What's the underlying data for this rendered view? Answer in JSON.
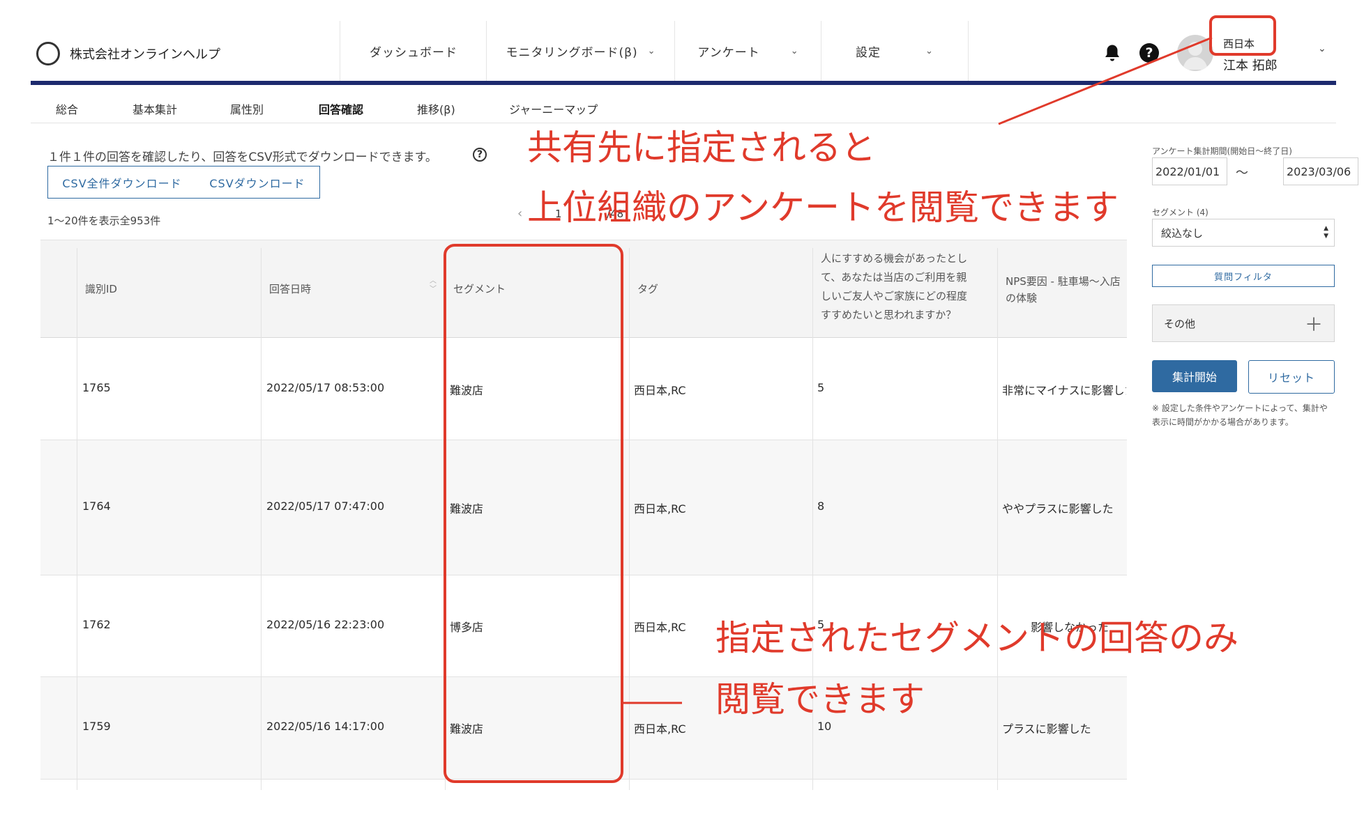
{
  "header": {
    "company": "株式会社オンラインヘルプ",
    "nav": [
      {
        "label": "ダッシュボード",
        "caret": ""
      },
      {
        "label": "モニタリングボード(β)",
        "caret": "⌄"
      },
      {
        "label": "アンケート",
        "caret": "⌄"
      },
      {
        "label": "設定",
        "caret": "⌄"
      }
    ],
    "user_org": "西日本",
    "user_name": "江本 拓郎",
    "user_caret": "⌄"
  },
  "subtabs": [
    "総合",
    "基本集計",
    "属性別",
    "回答確認",
    "推移(β)",
    "ジャーニーマップ"
  ],
  "main": {
    "description": "１件１件の回答を確認したり、回答をCSV形式でダウンロードできます。",
    "csv_all_button": "CSV全件ダウンロード",
    "csv_button": "CSVダウンロード",
    "count_text": "1〜20件を表示全953件",
    "pager_current": "1",
    "pager_total": "/48"
  },
  "table": {
    "headers": [
      "識別ID",
      "回答日時",
      "セグメント",
      "タグ",
      "人にすすめる機会があったとして、あなたは当店のご利用を親しいご友人やご家族にどの程度すすめたいと思われますか？",
      "NPS要因 - 駐車場〜入店の体験"
    ],
    "rows": [
      [
        "1765",
        "2022/05/17 08:53:00",
        "難波店",
        "西日本,RC",
        "5",
        "非常にマイナスに影響した"
      ],
      [
        "1764",
        "2022/05/17 07:47:00",
        "難波店",
        "西日本,RC",
        "8",
        "ややプラスに影響した"
      ],
      [
        "1762",
        "2022/05/16 22:23:00",
        "博多店",
        "西日本,RC",
        "5",
        "影響しなかった"
      ],
      [
        "1759",
        "2022/05/16 14:17:00",
        "難波店",
        "西日本,RC",
        "10",
        "プラスに影響した"
      ]
    ]
  },
  "sidebar": {
    "period_label": "アンケート集計期間(開始日〜終了日)",
    "start_date": "2022/01/01",
    "range_sep": "〜",
    "end_date": "2023/03/06",
    "segment_label": "セグメント (4)",
    "segment_value": "絞込なし",
    "question_filter": "質問フィルタ",
    "other_label": "その他",
    "start_button": "集計開始",
    "reset_button": "リセット",
    "note": "※ 設定した条件やアンケートによって、集計や表示に時間がかかる場合があります。"
  },
  "annotations": {
    "top_line1": "共有先に指定されると",
    "top_line2": "上位組織のアンケートを閲覧できます",
    "bottom_line1": "指定されたセグメントの回答のみ",
    "bottom_line2": "閲覧できます"
  },
  "colors": {
    "brand_bar": "#1d2a6e",
    "accent": "#2f6aa1",
    "annotation": "#e03a2b"
  }
}
